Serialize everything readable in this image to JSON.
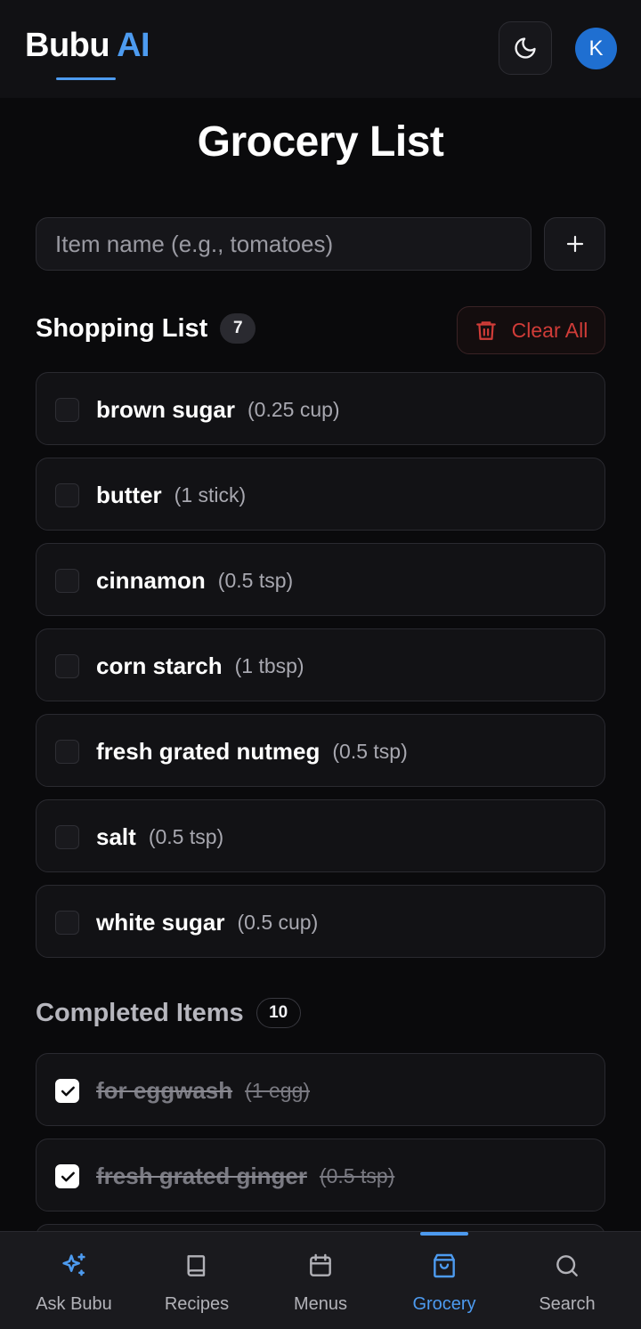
{
  "header": {
    "brand_name": "Bubu",
    "brand_ai": "AI",
    "avatar_initial": "K",
    "accent_color": "#4d9bf0"
  },
  "page": {
    "title": "Grocery List"
  },
  "add_item": {
    "placeholder": "Item name (e.g., tomatoes)",
    "value": "",
    "add_icon": "plus-icon"
  },
  "shopping": {
    "heading": "Shopping List",
    "count": "7",
    "clear_label": "Clear All",
    "clear_icon": "trash-icon",
    "danger_color": "#d03c38",
    "items": [
      {
        "name": "brown sugar",
        "qty": "(0.25 cup)"
      },
      {
        "name": "butter",
        "qty": "(1 stick)"
      },
      {
        "name": "cinnamon",
        "qty": "(0.5 tsp)"
      },
      {
        "name": "corn starch",
        "qty": "(1 tbsp)"
      },
      {
        "name": "fresh grated nutmeg",
        "qty": "(0.5 tsp)"
      },
      {
        "name": "salt",
        "qty": "(0.5 tsp)"
      },
      {
        "name": "white sugar",
        "qty": "(0.5 cup)"
      }
    ]
  },
  "completed": {
    "heading": "Completed Items",
    "count": "10",
    "items": [
      {
        "name": "for eggwash",
        "qty": "(1 egg)"
      },
      {
        "name": "fresh grated ginger",
        "qty": "(0.5 tsp)"
      }
    ]
  },
  "nav": {
    "items": [
      {
        "label": "Ask Bubu",
        "icon": "sparkle-icon"
      },
      {
        "label": "Recipes",
        "icon": "book-icon"
      },
      {
        "label": "Menus",
        "icon": "calendar-icon"
      },
      {
        "label": "Grocery",
        "icon": "shopping-bag-icon",
        "active": true
      },
      {
        "label": "Search",
        "icon": "search-icon"
      }
    ]
  }
}
